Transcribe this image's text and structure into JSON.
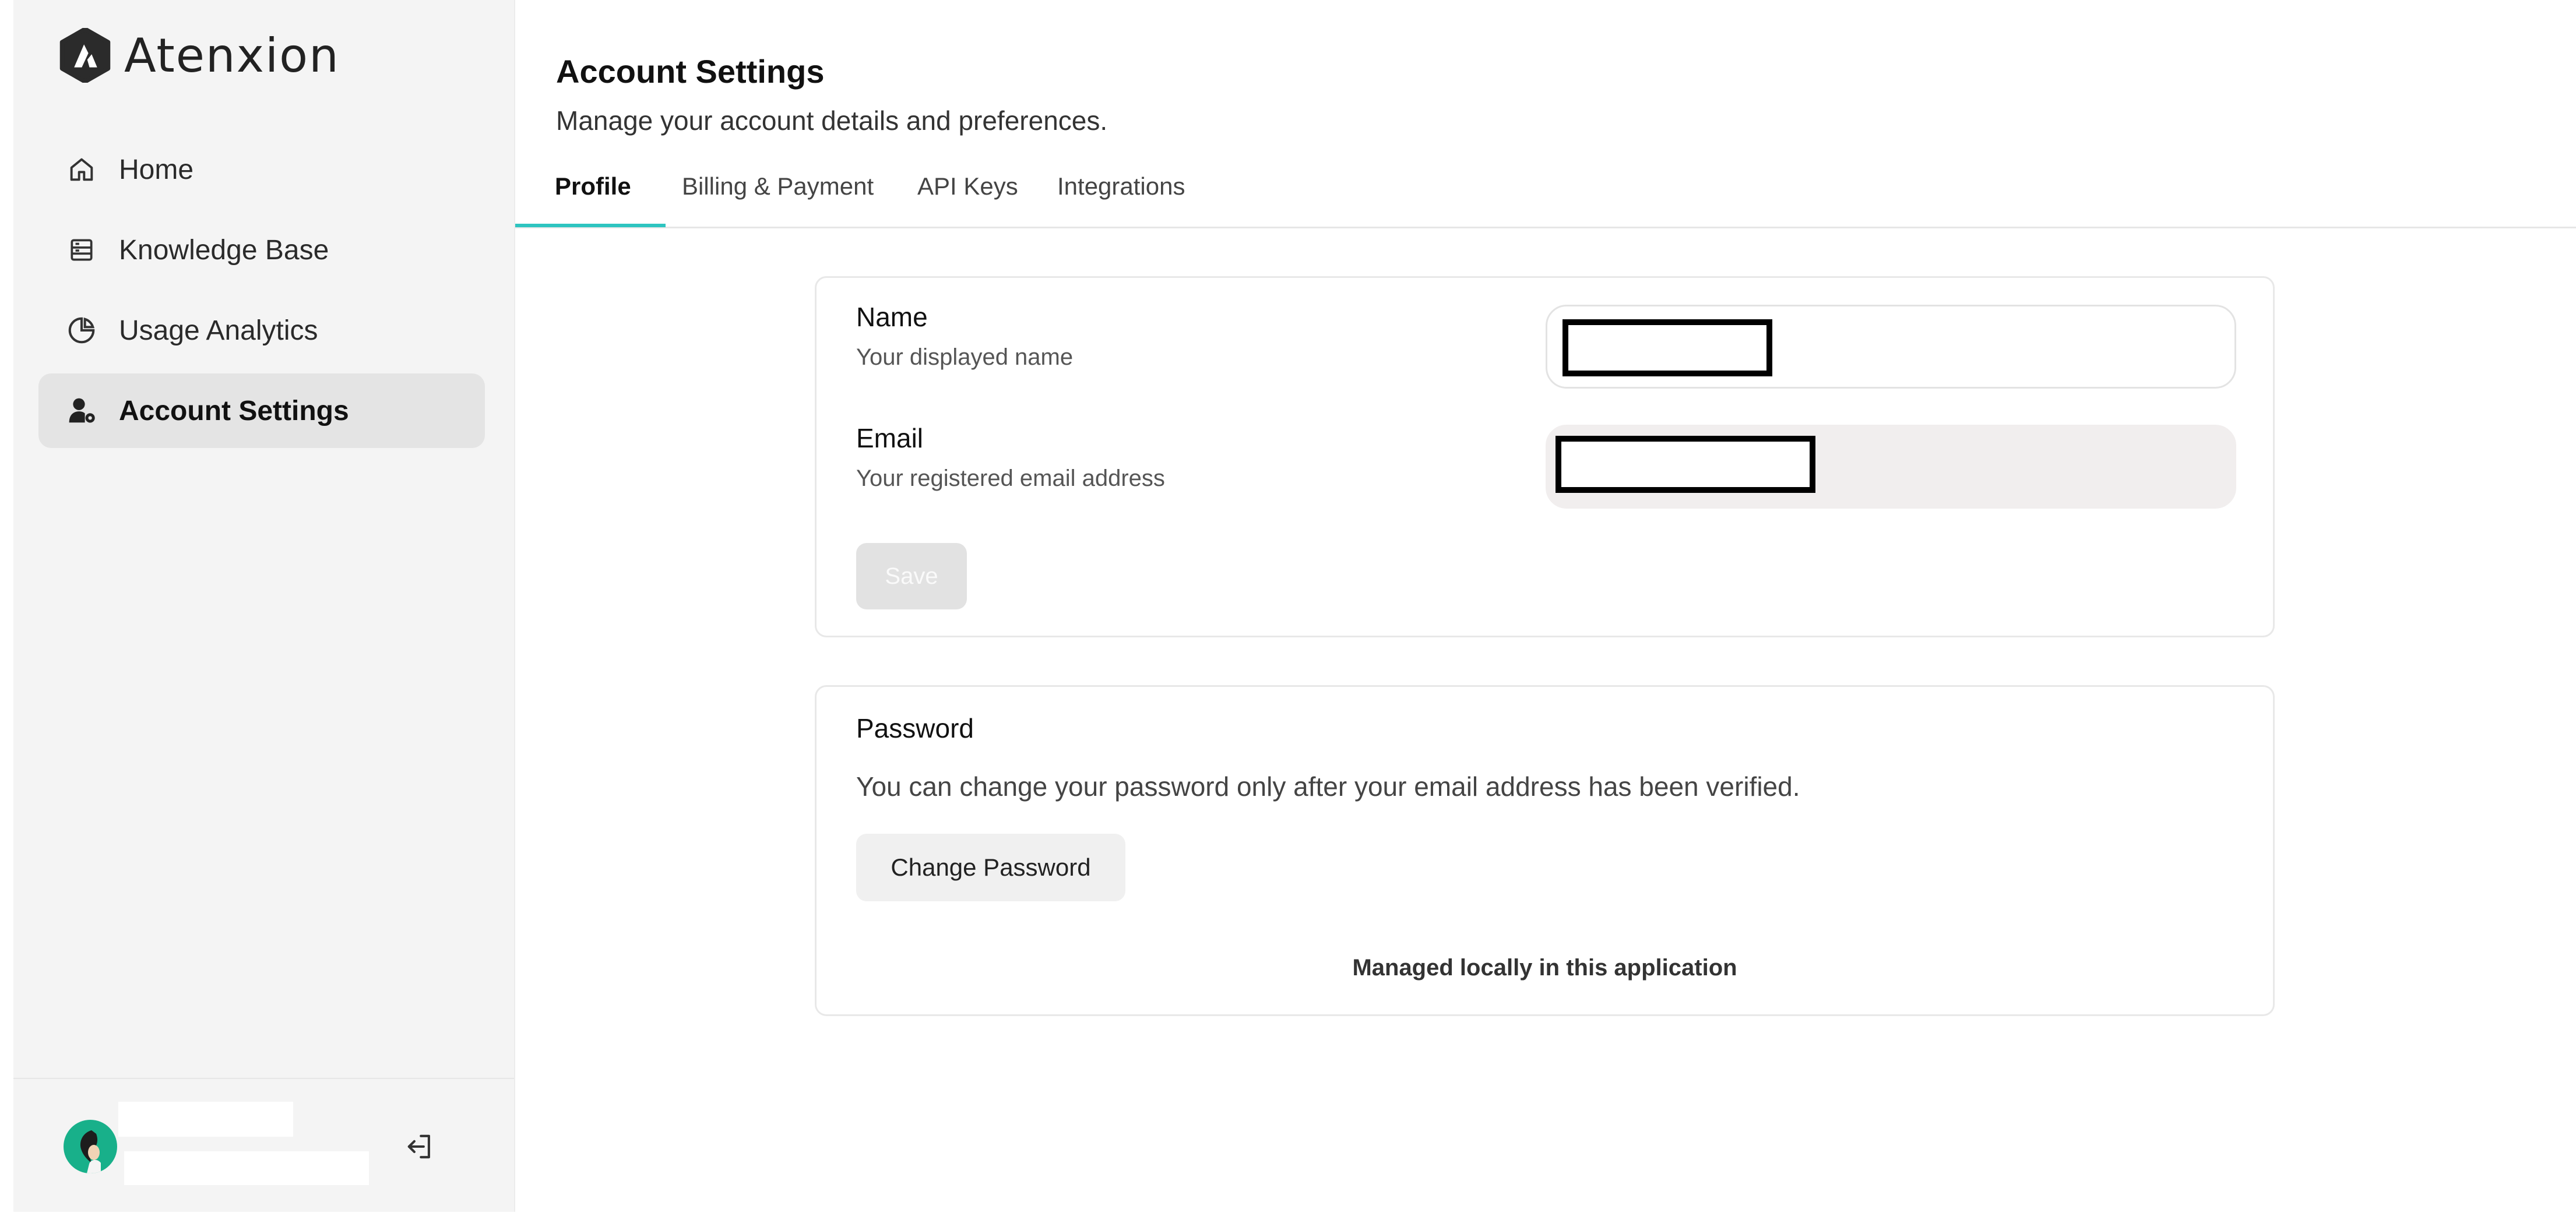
{
  "app": {
    "name": "Atenxion"
  },
  "sidebar": {
    "items": [
      {
        "label": "Home",
        "icon": "home-icon",
        "active": false
      },
      {
        "label": "Knowledge Base",
        "icon": "knowledge-base-icon",
        "active": false
      },
      {
        "label": "Usage Analytics",
        "icon": "pie-chart-icon",
        "active": false
      },
      {
        "label": "Account Settings",
        "icon": "account-settings-icon",
        "active": true
      }
    ],
    "footer": {
      "avatar_icon": "avatar",
      "logout_icon": "logout-icon"
    }
  },
  "header": {
    "title": "Account Settings",
    "subtitle": "Manage your account details and preferences."
  },
  "tabs": [
    {
      "label": "Profile",
      "active": true
    },
    {
      "label": "Billing & Payment",
      "active": false
    },
    {
      "label": "API Keys",
      "active": false
    },
    {
      "label": "Integrations",
      "active": false
    }
  ],
  "profile": {
    "name_label": "Name",
    "name_help": "Your displayed name",
    "email_label": "Email",
    "email_help": "Your registered email address",
    "save_label": "Save"
  },
  "password": {
    "title": "Password",
    "text": "You can change your password only after your email address has been verified.",
    "button_label": "Change Password",
    "note": "Managed locally in this application"
  },
  "colors": {
    "accent": "#2ec4c0",
    "sidebar_bg": "#f4f4f4",
    "active_item_bg": "#e4e4e4",
    "avatar_bg": "#18b08a"
  }
}
